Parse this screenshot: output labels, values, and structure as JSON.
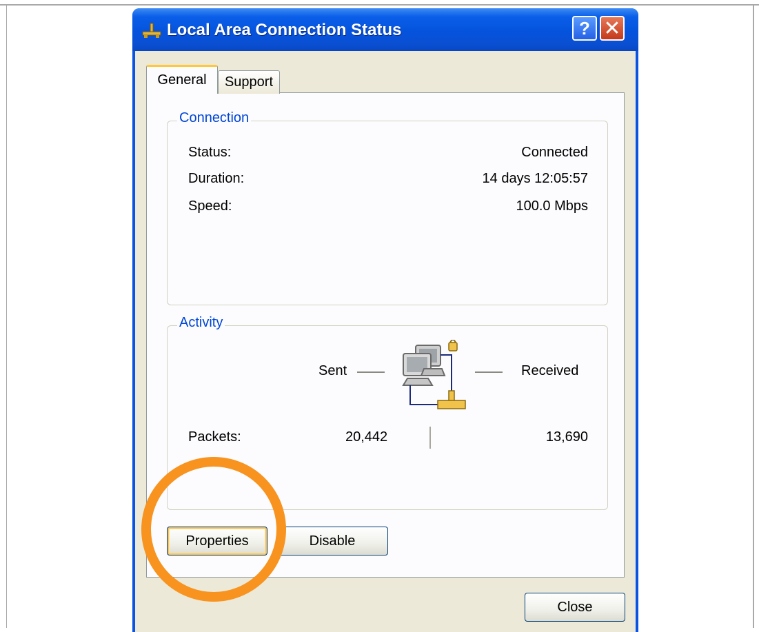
{
  "window": {
    "title": "Local Area Connection Status",
    "help_label": "?",
    "close_label": "✕"
  },
  "tabs": [
    {
      "label": "General",
      "selected": true
    },
    {
      "label": "Support",
      "selected": false
    }
  ],
  "connection": {
    "legend": "Connection",
    "rows": [
      {
        "label": "Status:",
        "value": "Connected"
      },
      {
        "label": "Duration:",
        "value": "14 days 12:05:57"
      },
      {
        "label": "Speed:",
        "value": "100.0 Mbps"
      }
    ]
  },
  "activity": {
    "legend": "Activity",
    "sent_label": "Sent",
    "received_label": "Received",
    "packets_label": "Packets:",
    "packets_sent": "20,442",
    "packets_received": "13,690"
  },
  "buttons": {
    "properties": "Properties",
    "disable": "Disable",
    "close": "Close"
  },
  "colors": {
    "titlebar": "#0553dd",
    "legend_text": "#0046d5",
    "highlight": "#f7931e"
  }
}
